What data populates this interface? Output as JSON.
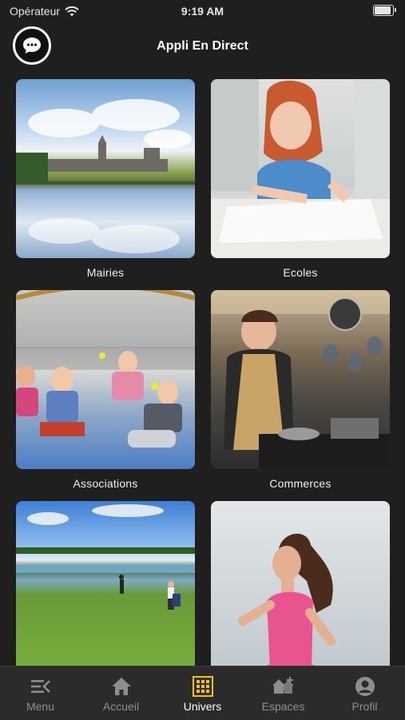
{
  "status_bar": {
    "carrier": "Opérateur",
    "time": "9:19 AM"
  },
  "header": {
    "title": "Appli En Direct",
    "chat_icon": "chat-bubble-icon"
  },
  "cards": [
    {
      "label": "Mairies",
      "image": "lakeside-village-photo"
    },
    {
      "label": "Ecoles",
      "image": "girl-drawing-photo"
    },
    {
      "label": "Associations",
      "image": "children-tennis-photo"
    },
    {
      "label": "Commerces",
      "image": "market-stall-photo"
    },
    {
      "label": "",
      "image": "golf-course-photo"
    },
    {
      "label": "",
      "image": "woman-running-photo"
    }
  ],
  "tabbar": {
    "items": [
      {
        "label": "Menu",
        "icon": "menu-icon",
        "active": false
      },
      {
        "label": "Accueil",
        "icon": "home-icon",
        "active": false
      },
      {
        "label": "Univers",
        "icon": "grid-icon",
        "active": true
      },
      {
        "label": "Espaces",
        "icon": "spaces-icon",
        "active": false
      },
      {
        "label": "Profil",
        "icon": "profile-icon",
        "active": false
      }
    ],
    "active_color": "#f5c400",
    "inactive_color": "#8e8e8e"
  }
}
